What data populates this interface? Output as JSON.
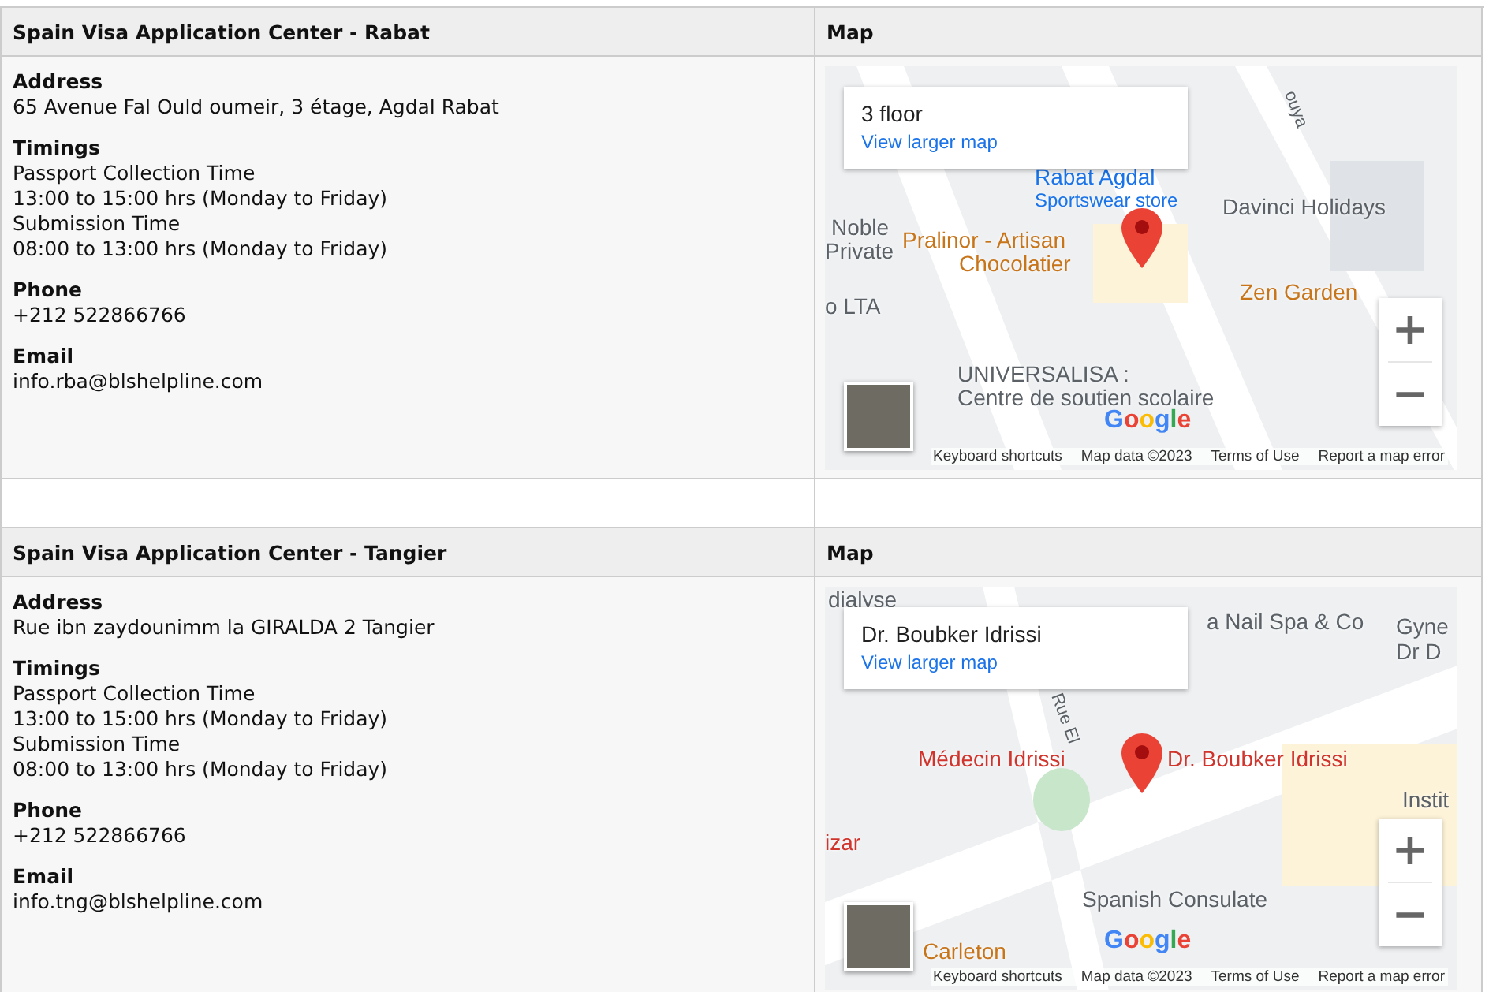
{
  "centers": [
    {
      "title": "Spain Visa Application Center - Rabat",
      "map_heading": "Map",
      "sections": [
        {
          "heading": "Address",
          "lines": [
            "65 Avenue Fal Ould oumeir, 3 étage, Agdal Rabat"
          ]
        },
        {
          "heading": "Timings",
          "lines": [
            "Passport Collection Time",
            "13:00 to 15:00 hrs (Monday to Friday)",
            "Submission Time",
            "08:00 to 13:00 hrs (Monday to Friday)"
          ]
        },
        {
          "heading": "Phone",
          "lines": [
            "+212 522866766"
          ]
        },
        {
          "heading": "Email",
          "lines": [
            "info.rba@blshelpline.com"
          ]
        }
      ],
      "map": {
        "card_title": "3 floor",
        "card_link": "View larger map",
        "places": [
          {
            "text": "Rabat Agdal",
            "kind": "shop"
          },
          {
            "text": "Sportswear store",
            "kind": "shop_detail"
          },
          {
            "text": "Davinci Holidays",
            "kind": "place"
          },
          {
            "text": "Pralinor - Artisan",
            "kind": "food"
          },
          {
            "text": "Chocolatier",
            "kind": "food"
          },
          {
            "text": "Zen Garden",
            "kind": "food"
          },
          {
            "text": "UNIVERSALISA :",
            "kind": "place"
          },
          {
            "text": "Centre de soutien scolaire",
            "kind": "place"
          },
          {
            "text": "Noble",
            "kind": "place"
          },
          {
            "text": "Private",
            "kind": "place"
          },
          {
            "text": "o LTA",
            "kind": "place"
          },
          {
            "text": "ouya",
            "kind": "street"
          }
        ],
        "logo": "Google",
        "zoom_in": "+",
        "zoom_out": "−",
        "footer": [
          "Keyboard shortcuts",
          "Map data ©2023",
          "Terms of Use",
          "Report a map error"
        ]
      }
    },
    {
      "title": "Spain Visa Application Center - Tangier",
      "map_heading": "Map",
      "sections": [
        {
          "heading": "Address",
          "lines": [
            "Rue ibn zaydounimm la GIRALDA 2 Tangier"
          ]
        },
        {
          "heading": "Timings",
          "lines": [
            "Passport Collection Time",
            "13:00 to 15:00 hrs (Monday to Friday)",
            "Submission Time",
            "08:00 to 13:00 hrs (Monday to Friday)"
          ]
        },
        {
          "heading": "Phone",
          "lines": [
            "+212 522866766"
          ]
        },
        {
          "heading": "Email",
          "lines": [
            "info.tng@blshelpline.com"
          ]
        }
      ],
      "map": {
        "card_title": "Dr. Boubker Idrissi",
        "card_link": "View larger map",
        "places": [
          {
            "text": "Médecin Idrissi",
            "kind": "health"
          },
          {
            "text": "Dr. Boubker Idrissi",
            "kind": "health"
          },
          {
            "text": "Spanish Consulate",
            "kind": "place"
          },
          {
            "text": "a Nail Spa & Co",
            "kind": "place"
          },
          {
            "text": "dialyse",
            "kind": "place"
          },
          {
            "text": "Instit",
            "kind": "place"
          },
          {
            "text": "izar",
            "kind": "health"
          },
          {
            "text": "Carleton",
            "kind": "food"
          },
          {
            "text": "Rue El",
            "kind": "street"
          },
          {
            "text": "Gyne",
            "kind": "place"
          },
          {
            "text": "Dr D",
            "kind": "place"
          }
        ],
        "logo": "Google",
        "zoom_in": "+",
        "zoom_out": "−",
        "footer": [
          "Keyboard shortcuts",
          "Map data ©2023",
          "Terms of Use",
          "Report a map error"
        ]
      }
    }
  ]
}
